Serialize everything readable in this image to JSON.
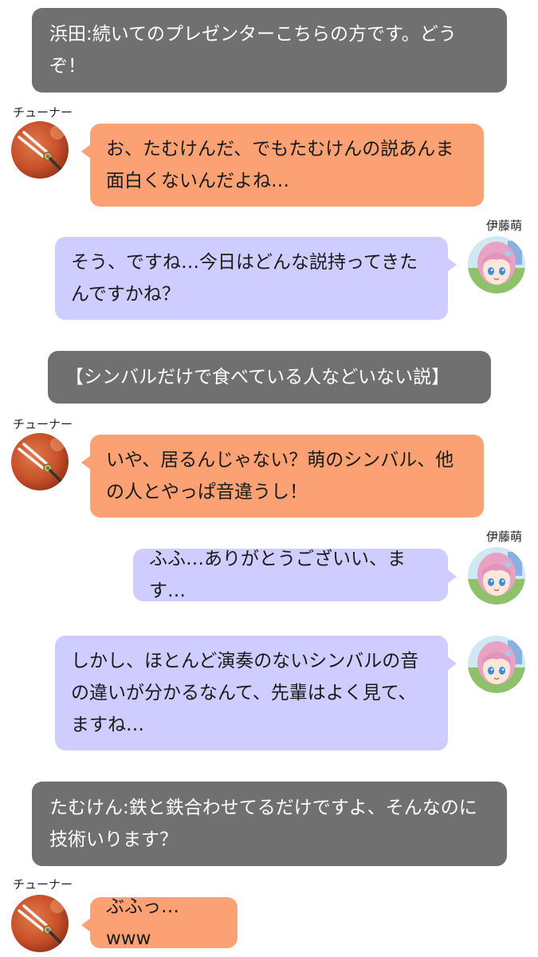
{
  "messages": [
    {
      "kind": "narration",
      "text": "浜田:続いてのプレゼンターこちらの方です。どうぞ！"
    },
    {
      "kind": "left",
      "speaker": "チューナー",
      "text": "お、たむけんだ、でもたむけんの説あんま面白くないんだよね…"
    },
    {
      "kind": "right",
      "speaker": "伊藤萌",
      "text": "そう、ですね…今日はどんな説持ってきたんですかね？"
    },
    {
      "kind": "narration",
      "text": "【シンバルだけで食べている人などいない説】"
    },
    {
      "kind": "left",
      "speaker": "チューナー",
      "text": "いや、居るんじゃない？萌のシンバル、他の人とやっぱ音違うし！"
    },
    {
      "kind": "right",
      "speaker": "伊藤萌",
      "text": "ふふ…ありがとうございい、ます…"
    },
    {
      "kind": "right",
      "speaker": "",
      "text": "しかし、ほとんど演奏のないシンバルの音の違いが分かるなんて、先輩はよく見て、ますね…"
    },
    {
      "kind": "narration",
      "text": "たむけん:鉄と鉄合わせてるだけですよ、そんなのに技術いります？"
    },
    {
      "kind": "left",
      "speaker": "チューナー",
      "text": "ぶふっ…www"
    }
  ],
  "avatars": {
    "tuner": "tuning-fork-avatar-icon",
    "moe": "pink-hair-girl-avatar-icon"
  },
  "colors": {
    "narration_bg": "#707070",
    "tuner_bubble": "#fca173",
    "moe_bubble": "#cfccff"
  }
}
